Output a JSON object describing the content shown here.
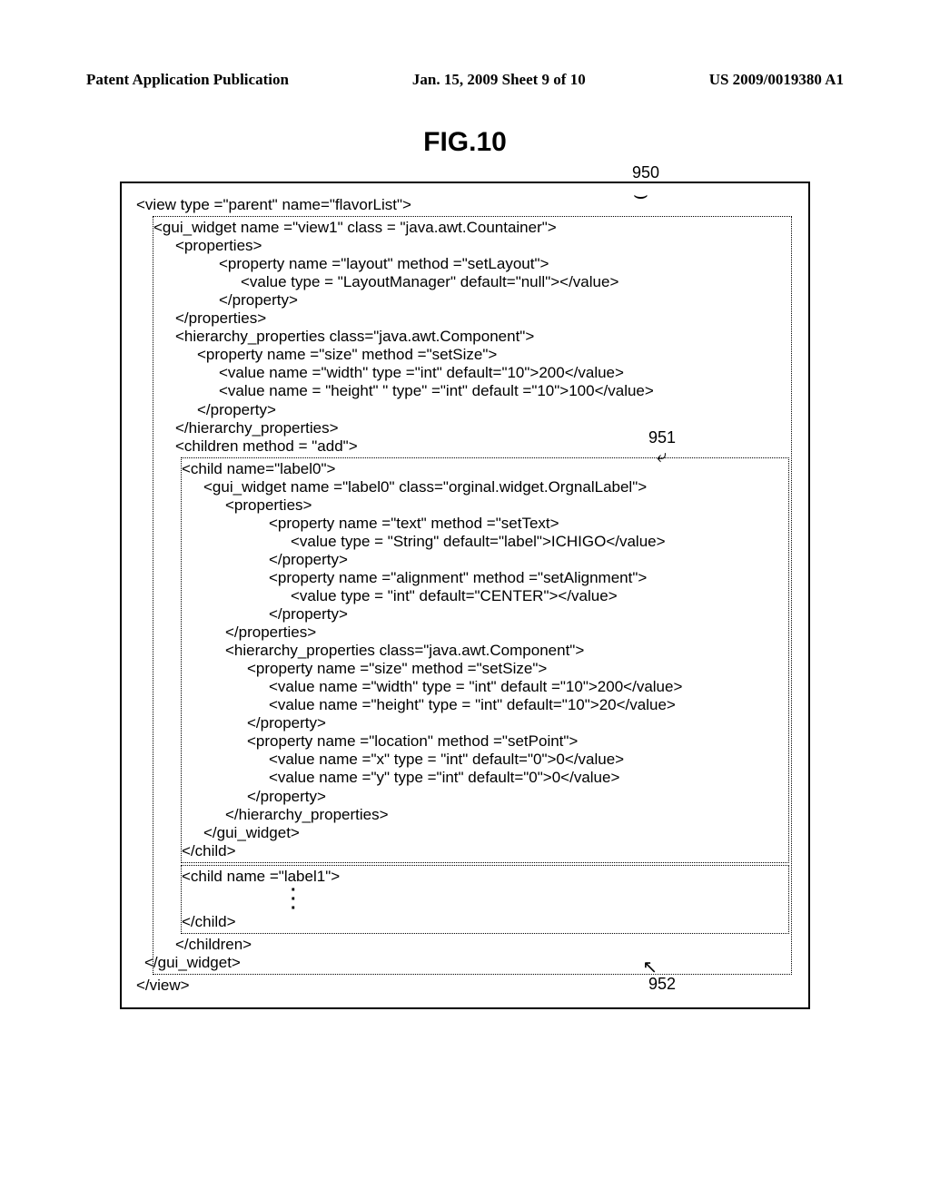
{
  "header": {
    "left": "Patent Application Publication",
    "center": "Jan. 15, 2009  Sheet 9 of 10",
    "right": "US 2009/0019380 A1"
  },
  "figure_label": "FIG.10",
  "callouts": {
    "c950": "950",
    "c951": "951",
    "c952": "952"
  },
  "code": {
    "l01": "<view type =\"parent\" name=\"flavorList\">",
    "l02": "<gui_widget name =\"view1\" class = \"java.awt.Countainer\">",
    "l03": "<properties>",
    "l04": "<property name =\"layout\" method =\"setLayout\">",
    "l05": "<value type = \"LayoutManager\" default=\"null\"></value>",
    "l06": "</property>",
    "l07": "</properties>",
    "l08": "<hierarchy_properties class=\"java.awt.Component\">",
    "l09": "<property name =\"size\" method =\"setSize\">",
    "l10": "<value name =\"width\" type =\"int\" default=\"10\">200</value>",
    "l11": "<value name = \"height\" \" type\" =\"int\" default =\"10\">100</value>",
    "l12": "</property>",
    "l13": "</hierarchy_properties>",
    "l14": "<children method = \"add\">",
    "l15": "<child name=\"label0\">",
    "l16": "<gui_widget name =\"label0\" class=\"orginal.widget.OrgnalLabel\">",
    "l17": "<properties>",
    "l18": "<property name =\"text\" method =\"setText>",
    "l19": "<value type = \"String\" default=\"label\">ICHIGO</value>",
    "l20": "</property>",
    "l21": "<property name =\"alignment\" method =\"setAlignment\">",
    "l22": "<value type = \"int\" default=\"CENTER\"></value>",
    "l23": "</property>",
    "l24": "</properties>",
    "l25": "<hierarchy_properties class=\"java.awt.Component\">",
    "l26": "<property name =\"size\" method =\"setSize\">",
    "l27": "<value name =\"width\" type = \"int\" default =\"10\">200</value>",
    "l28": "<value name =\"height\" type = \"int\" default=\"10\">20</value>",
    "l29": "</property>",
    "l30": "<property name =\"location\" method =\"setPoint\">",
    "l31": "<value name =\"x\" type = \"int\" default=\"0\">0</value>",
    "l32": "<value name =\"y\" type =\"int\" default=\"0\">0</value>",
    "l33": "</property>",
    "l34": "</hierarchy_properties>",
    "l35": "</gui_widget>",
    "l36": "</child>",
    "l37": "<child name =\"label1\">",
    "l38": "</child>",
    "l39": "</children>",
    "l40": "</gui_widget>",
    "l41": "</view>"
  }
}
